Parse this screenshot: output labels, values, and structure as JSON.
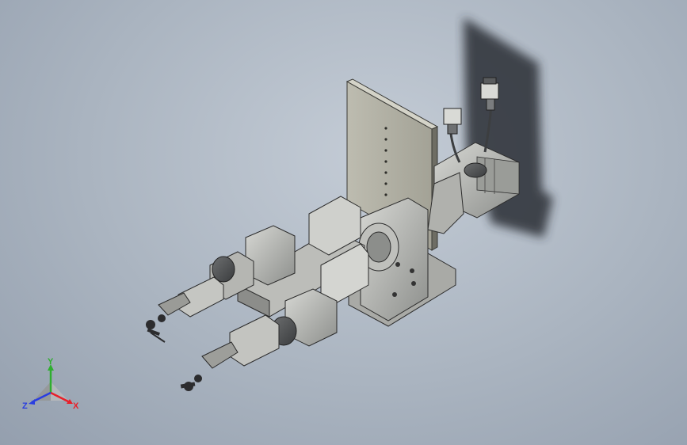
{
  "viewport": {
    "background": "gradient-gray-blue",
    "model": "cad-assembly-3d-isometric"
  },
  "triad": {
    "x_label": "X",
    "y_label": "Y",
    "z_label": "Z",
    "x_color": "#e8202a",
    "y_color": "#2fae2f",
    "z_color": "#2a3ee0"
  }
}
